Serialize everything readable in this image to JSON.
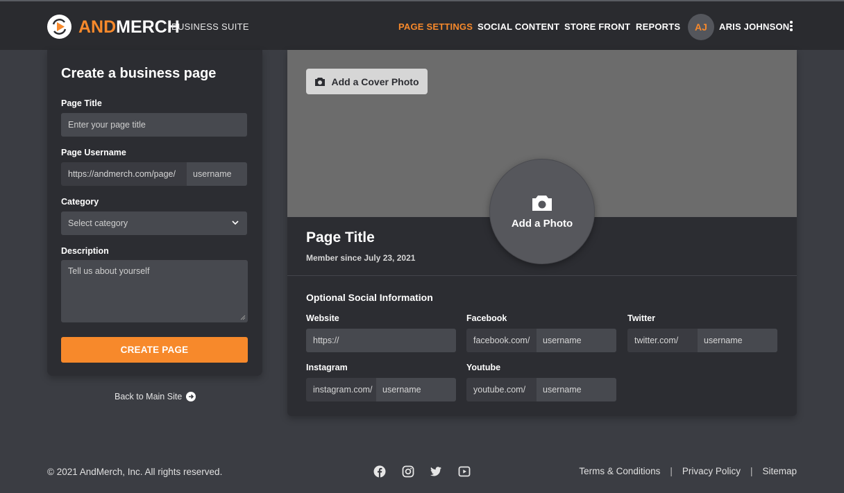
{
  "header": {
    "logo_text_a": "AND",
    "logo_text_b": "MERCH",
    "logo_sub": "BUSINESS SUITE",
    "nav": [
      "PAGE SETTINGS",
      "SOCIAL CONTENT",
      "STORE FRONT",
      "REPORTS"
    ],
    "avatar_initials": "AJ",
    "user_name": "ARIS JOHNSON"
  },
  "form": {
    "title": "Create a business page",
    "page_title_label": "Page Title",
    "page_title_placeholder": "Enter your page title",
    "username_label": "Page Username",
    "username_prefix": "https://andmerch.com/page/",
    "username_placeholder": "username",
    "category_label": "Category",
    "category_value": "Select category",
    "description_label": "Description",
    "description_placeholder": "Tell us about yourself",
    "submit_label": "CREATE PAGE",
    "back_link": "Back to Main Site"
  },
  "preview": {
    "cover_button": "Add a Cover Photo",
    "photo_button": "Add a Photo",
    "page_title": "Page Title",
    "member_since": "Member since July 23, 2021",
    "social_title": "Optional Social Information",
    "website_label": "Website",
    "website_placeholder": "https://",
    "facebook_label": "Facebook",
    "facebook_prefix": "facebook.com/",
    "twitter_label": "Twitter",
    "twitter_prefix": "twitter.com/",
    "instagram_label": "Instagram",
    "instagram_prefix": "instagram.com/",
    "youtube_label": "Youtube",
    "youtube_prefix": "youtube.com/",
    "username_placeholder": "username"
  },
  "footer": {
    "copyright": "© 2021 AndMerch, Inc. All rights reserved.",
    "links": [
      "Terms & Conditions",
      "Privacy Policy",
      "Sitemap"
    ],
    "social_icons": [
      "facebook-icon",
      "instagram-icon",
      "twitter-icon",
      "youtube-icon"
    ]
  },
  "colors": {
    "accent": "#f7892b",
    "background": "#3b3d43",
    "header": "#2a2b2f",
    "card": "#2c2d32"
  }
}
